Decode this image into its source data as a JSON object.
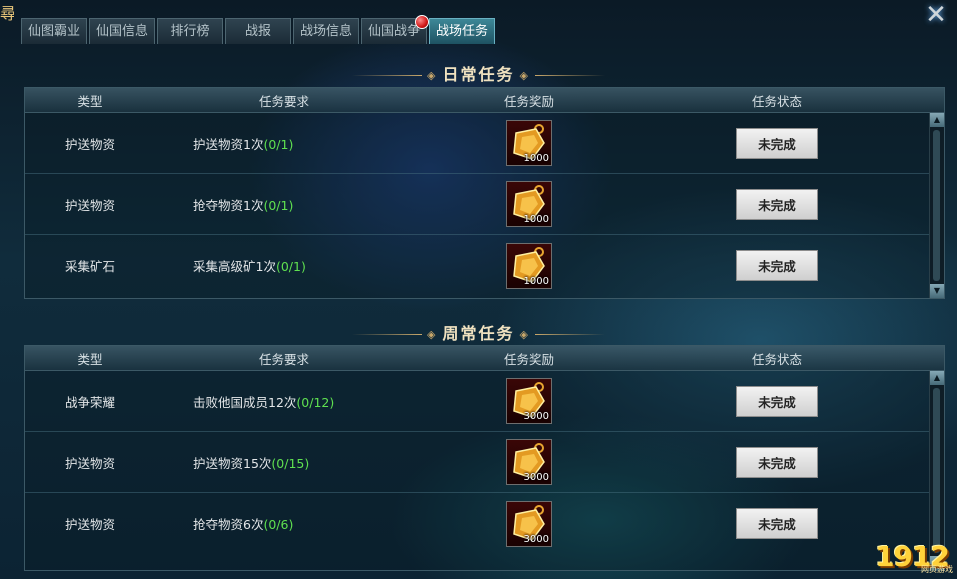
{
  "corner_text": "尋",
  "tabs": [
    {
      "label": "仙图霸业",
      "active": false,
      "badge": false
    },
    {
      "label": "仙国信息",
      "active": false,
      "badge": false
    },
    {
      "label": "排行榜",
      "active": false,
      "badge": false
    },
    {
      "label": "战报",
      "active": false,
      "badge": false
    },
    {
      "label": "战场信息",
      "active": false,
      "badge": false
    },
    {
      "label": "仙国战争",
      "active": false,
      "badge": true
    },
    {
      "label": "战场任务",
      "active": true,
      "badge": false
    }
  ],
  "columns": {
    "type": "类型",
    "requirement": "任务要求",
    "reward": "任务奖励",
    "status": "任务状态"
  },
  "daily": {
    "title": "日常任务",
    "rows": [
      {
        "type": "护送物资",
        "requirement": "护送物资1次",
        "progress": "(0/1)",
        "reward_count": "1000",
        "status": "未完成"
      },
      {
        "type": "护送物资",
        "requirement": "抢夺物资1次",
        "progress": "(0/1)",
        "reward_count": "1000",
        "status": "未完成"
      },
      {
        "type": "采集矿石",
        "requirement": "采集高级矿1次",
        "progress": "(0/1)",
        "reward_count": "1000",
        "status": "未完成"
      }
    ]
  },
  "weekly": {
    "title": "周常任务",
    "rows": [
      {
        "type": "战争荣耀",
        "requirement": "击败他国成员12次",
        "progress": "(0/12)",
        "reward_count": "3000",
        "status": "未完成"
      },
      {
        "type": "护送物资",
        "requirement": "护送物资15次",
        "progress": "(0/15)",
        "reward_count": "3000",
        "status": "未完成"
      },
      {
        "type": "护送物资",
        "requirement": "抢夺物资6次",
        "progress": "(0/6)",
        "reward_count": "3000",
        "status": "未完成"
      }
    ]
  },
  "watermark": {
    "brand": "1912",
    "sub": "网页游戏"
  },
  "colors": {
    "progress": "#5fe050",
    "active_tab": "#3d8797",
    "title_gold": "#f0e2c0"
  }
}
